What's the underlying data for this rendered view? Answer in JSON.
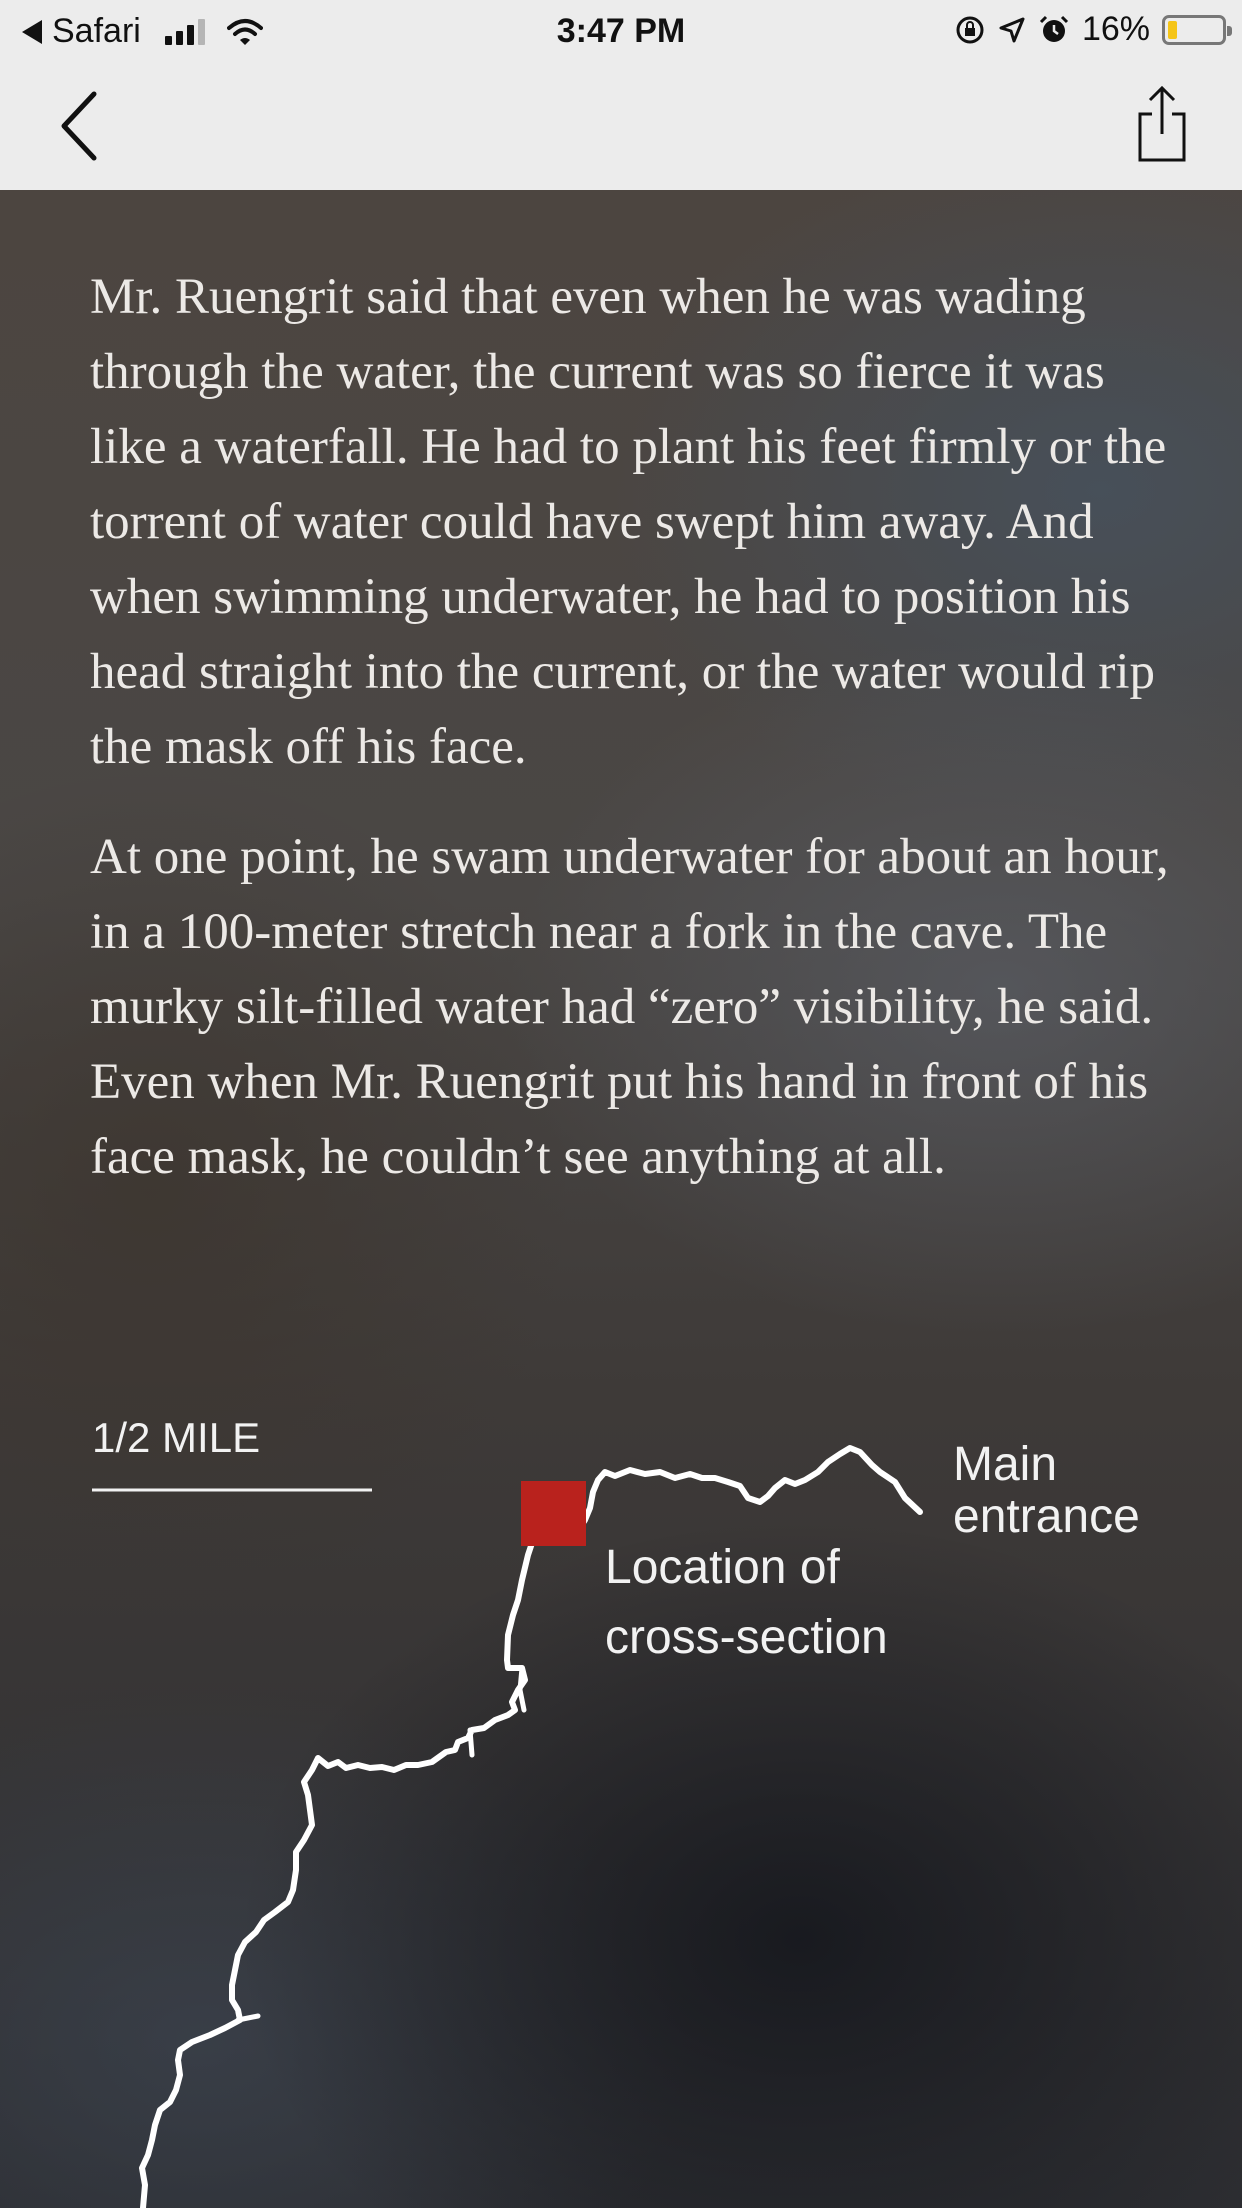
{
  "status_bar": {
    "back_app": "Safari",
    "time": "3:47 PM",
    "battery": "16%"
  },
  "nav": {
    "back_icon": "chevron-left-icon",
    "share_icon": "share-icon"
  },
  "article": {
    "paragraphs": [
      "Mr. Ruengrit said that even when he was wading through the water, the current was so fierce it was like a waterfall. He had to plant his feet firmly or the torrent of water could have swept him away. And when swimming underwater, he had to position his head straight into the current, or the water would rip the mask off his face.",
      "At one point, he swam underwater for about an hour, in a 100-meter stretch near a fork in the cave. The murky silt-filled water had “zero” visibility, he said. Even when Mr. Ruengrit put his hand in front of his face mask, he couldn’t see anything at all."
    ]
  },
  "map": {
    "scale_label": "1/2 MILE",
    "main_entrance_line1": "Main",
    "main_entrance_line2": "entrance",
    "cross_section_line1": "Location of",
    "cross_section_line2": "cross-section",
    "marker_color": "#b9221d",
    "route_color": "#ffffff"
  }
}
